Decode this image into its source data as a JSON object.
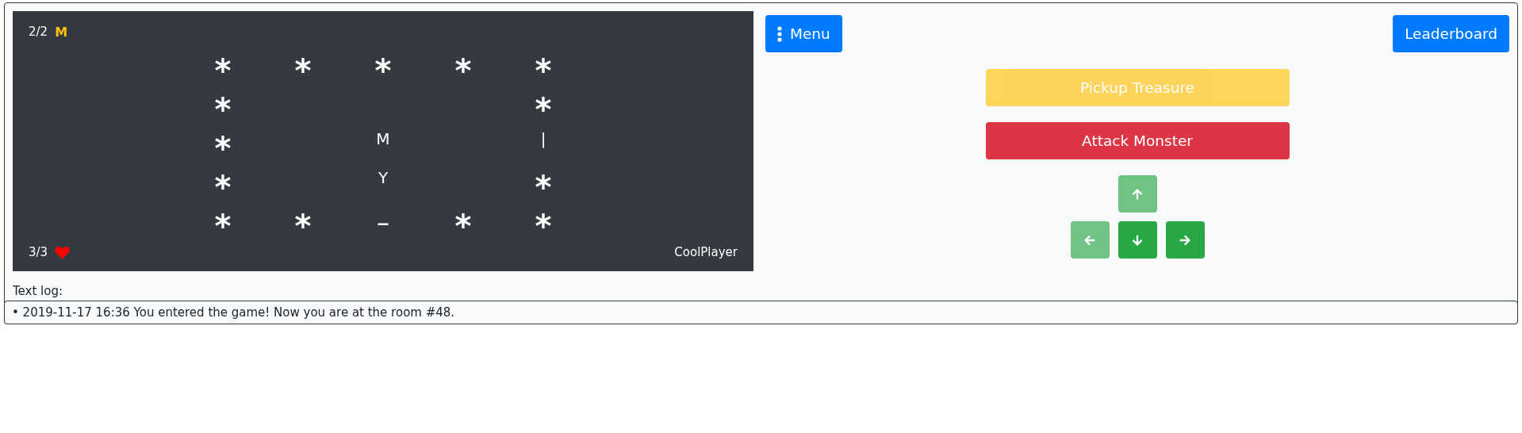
{
  "game": {
    "treasure": {
      "count": "2/2",
      "icon": "M"
    },
    "health": {
      "count": "3/3"
    },
    "player": "CoolPlayer",
    "rows": [
      [
        {
          "text": "*",
          "kind": "wall"
        },
        {
          "text": "*",
          "kind": "wall"
        },
        {
          "text": "*",
          "kind": "wall"
        },
        {
          "text": "*",
          "kind": "wall"
        },
        {
          "text": "*",
          "kind": "wall"
        }
      ],
      [
        {
          "text": "*",
          "kind": "wall"
        },
        null,
        null,
        null,
        {
          "text": "*",
          "kind": "wall"
        }
      ],
      [
        {
          "text": "*",
          "kind": "wall"
        },
        null,
        {
          "text": "M",
          "kind": "item"
        },
        null,
        {
          "text": "|",
          "kind": "item"
        }
      ],
      [
        {
          "text": "*",
          "kind": "wall"
        },
        null,
        {
          "text": "Y",
          "kind": "item"
        },
        null,
        {
          "text": "*",
          "kind": "wall"
        }
      ],
      [
        {
          "text": "*",
          "kind": "wall"
        },
        {
          "text": "*",
          "kind": "wall"
        },
        {
          "text": "_",
          "kind": "door"
        },
        {
          "text": "*",
          "kind": "wall"
        },
        {
          "text": "*",
          "kind": "wall"
        }
      ]
    ]
  },
  "controls": {
    "menu": {
      "label": "Menu"
    },
    "leaderboard": {
      "label": "Leaderboard"
    },
    "actions": [
      {
        "label": "Pickup Treasure",
        "kind": "warning",
        "disabled": true
      },
      {
        "label": "Attack Monster",
        "kind": "danger",
        "disabled": false
      }
    ],
    "moves": [
      {
        "kind": "up",
        "disabled": true
      },
      {
        "kind": "left",
        "disabled": true
      },
      {
        "kind": "down",
        "disabled": false
      },
      {
        "kind": "right",
        "disabled": false
      }
    ]
  },
  "log": {
    "label": "Text log:",
    "entries": [
      "• 2019-11-17 16:36 You entered the game! Now you are at the room #48."
    ]
  }
}
